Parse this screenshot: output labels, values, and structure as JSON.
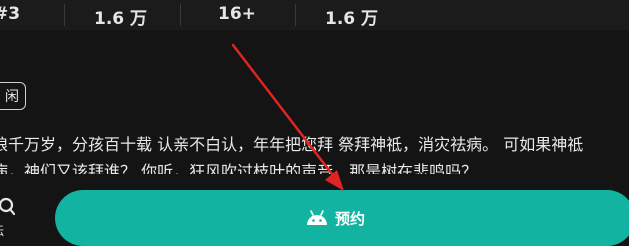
{
  "stats": [
    {
      "value": "#3"
    },
    {
      "value": "1.6 万"
    },
    {
      "value": "16+"
    },
    {
      "value": "1.6 万"
    }
  ],
  "tag": {
    "label": "闲"
  },
  "description": {
    "line1": "狼千万岁，分孩百十载 认亲不白认，年年把您拜 祭拜神祗，消灾祛病。 可如果神祗",
    "line2": "病，神们又该拜谁？ 你听，狂风吹过枝叶的声音，那是树在悲鸣吗？"
  },
  "bottom_nav": {
    "forum_label": "坛"
  },
  "reserve_button": {
    "label": "预约",
    "icon": "android-icon",
    "color": "#12b3a1"
  },
  "annotation": {
    "color": "#e02424"
  }
}
